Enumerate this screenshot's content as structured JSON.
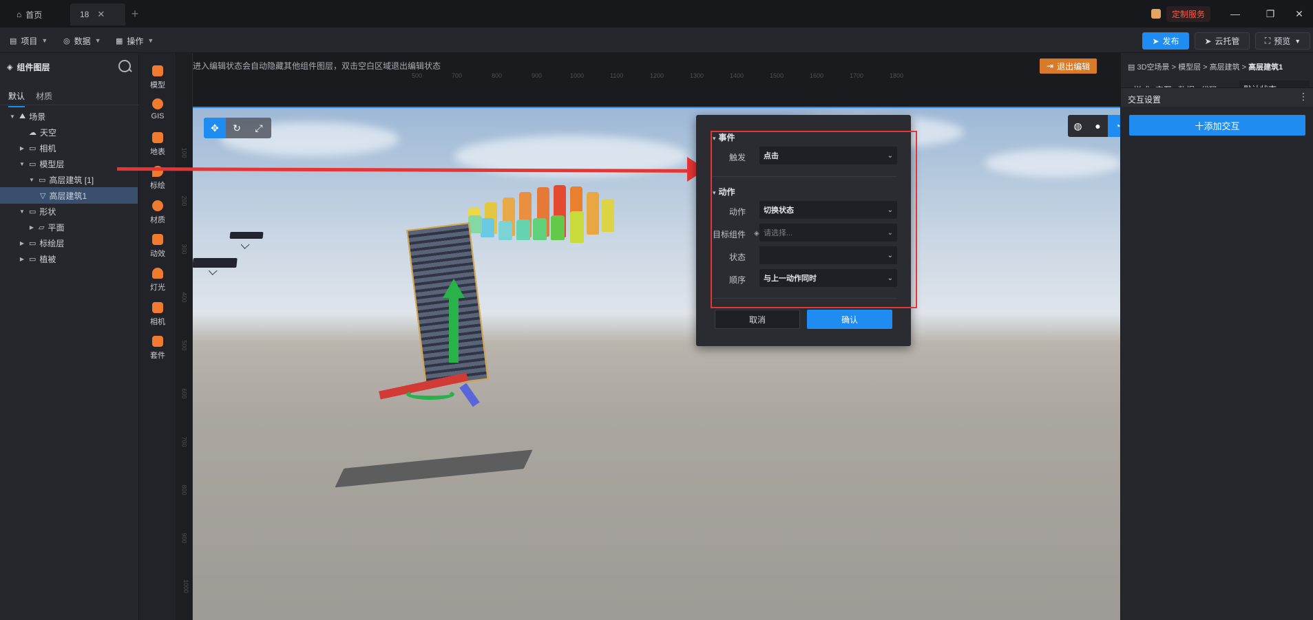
{
  "titlebar": {
    "home_tab": "首页",
    "active_tab": "18",
    "close_glyph": "✕",
    "new_tab_glyph": "+",
    "service_label": "定制服务",
    "minimize_glyph": "—",
    "restore_glyph": "❐",
    "close_window_glyph": "✕"
  },
  "menubar": {
    "items": [
      {
        "label": "项目",
        "icon": "file-icon"
      },
      {
        "label": "数据",
        "icon": "database-icon"
      },
      {
        "label": "操作",
        "icon": "grid-icon"
      }
    ],
    "publish_label": "发布",
    "cloud_label": "云托管",
    "preview_label": "预览"
  },
  "layers": {
    "title": "组件图层",
    "tabs": [
      "默认",
      "材质"
    ],
    "tree": [
      {
        "label": "场景",
        "level": 0,
        "expanded": true,
        "icon": "scene-icon"
      },
      {
        "label": "天空",
        "level": 1,
        "icon": "sky-icon"
      },
      {
        "label": "相机",
        "level": 1,
        "collapsed": true,
        "icon": "folder-icon"
      },
      {
        "label": "模型层",
        "level": 1,
        "expanded": true,
        "icon": "folder-icon"
      },
      {
        "label": "高层建筑 [1]",
        "level": 2,
        "expanded": true,
        "icon": "folder-icon"
      },
      {
        "label": "高层建筑1",
        "level": 3,
        "selected": true,
        "icon": "model-icon"
      },
      {
        "label": "形状",
        "level": 1,
        "expanded": true,
        "icon": "folder-icon"
      },
      {
        "label": "平面",
        "level": 2,
        "collapsed": true,
        "icon": "plane-icon"
      },
      {
        "label": "标绘层",
        "level": 1,
        "collapsed": true,
        "icon": "folder-icon"
      },
      {
        "label": "植被",
        "level": 1,
        "collapsed": true,
        "icon": "folder-icon"
      }
    ]
  },
  "rail": {
    "tools": [
      "模型",
      "GIS",
      "地表",
      "标绘",
      "材质",
      "动效",
      "灯光",
      "相机",
      "套件"
    ]
  },
  "canvas": {
    "hint": "进入编辑状态会自动隐藏其他组件图层，双击空白区域退出编辑状态",
    "exit_label": "退出编辑",
    "ruler_top": [
      "500",
      "700",
      "800",
      "900",
      "1000",
      "1100",
      "1200",
      "1300",
      "1400",
      "1500",
      "1600",
      "1700",
      "1800"
    ],
    "ruler_left": [
      "100",
      "200",
      "300",
      "400",
      "500",
      "600",
      "700",
      "800",
      "900",
      "1000"
    ]
  },
  "popup": {
    "event_section": "事件",
    "trigger_label": "触发",
    "trigger_value": "点击",
    "action_section": "动作",
    "action_label": "动作",
    "action_value": "切换状态",
    "target_label": "目标组件",
    "target_placeholder": "请选择...",
    "state_label": "状态",
    "state_value": "",
    "order_label": "顺序",
    "order_value": "与上一动作同时",
    "cancel_label": "取消",
    "ok_label": "确认"
  },
  "props": {
    "breadcrumb": [
      "3D空场景",
      "模型层",
      "高层建筑",
      "高层建筑1"
    ],
    "tabs": [
      "样式",
      "交互",
      "数据",
      "代码"
    ],
    "active_tab": "交互",
    "state_select": "默认状态",
    "section_title": "交互设置",
    "add_label": "十添加交互"
  },
  "colors": {
    "accent": "#1e8cf0",
    "annotation_red": "#e53535",
    "exit_orange": "#d77a2a"
  }
}
